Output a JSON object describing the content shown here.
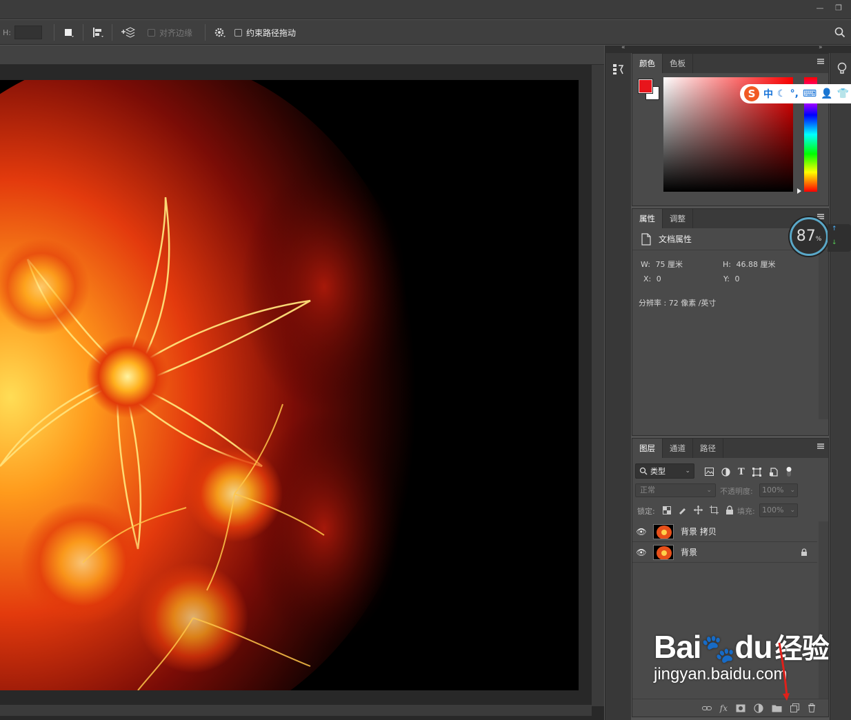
{
  "window": {
    "minimize": "—",
    "restore": "❐"
  },
  "options": {
    "h_label": "H:",
    "align_edges": "对齐边缘",
    "constrain_path": "约束路径拖动"
  },
  "color_panel": {
    "tabs": [
      "颜色",
      "色板"
    ],
    "foreground": "#e8151b",
    "background": "#ffffff"
  },
  "properties_panel": {
    "tabs": [
      "属性",
      "调整"
    ],
    "doc_title": "文档属性",
    "w_label": "W:",
    "w_value": "75 厘米",
    "h_label": "H:",
    "h_value": "46.88 厘米",
    "x_label": "X:",
    "x_value": "0",
    "y_label": "Y:",
    "y_value": "0",
    "resolution": "分辨率 : 72 像素 /英寸"
  },
  "layers_panel": {
    "tabs": [
      "图层",
      "通道",
      "路径"
    ],
    "filter_kind": "类型",
    "blend_mode": "正常",
    "opacity_label": "不透明度:",
    "opacity_value": "100%",
    "lock_label": "锁定:",
    "fill_label": "填充:",
    "fill_value": "100%",
    "layers": [
      {
        "name": "背景 拷贝",
        "locked": false
      },
      {
        "name": "背景",
        "locked": true
      }
    ],
    "footer_fx": "fx"
  },
  "overlay": {
    "ime_chars": "中",
    "gauge_value": "87",
    "gauge_unit": "%"
  },
  "watermark": {
    "brand": "Bai",
    "brand2": "du",
    "cn": "经验",
    "url": "jingyan.baidu.com"
  }
}
